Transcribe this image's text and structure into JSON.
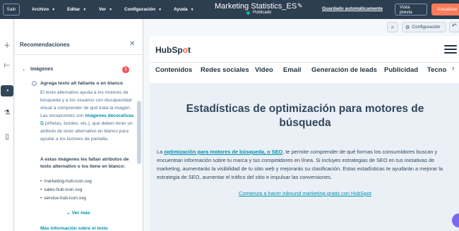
{
  "topbar": {
    "exit_label": "Salir",
    "menus": [
      "Archivo",
      "Editar",
      "Ver",
      "Configuración",
      "Ayuda"
    ],
    "doc_title": "Marketing Statistics_ES",
    "status": "Publicado",
    "autosave": "Guardado automáticamente",
    "preview_label": "Vista previa",
    "update_label": "Actualizar"
  },
  "panel": {
    "title": "Recomendaciones",
    "section_title": "Imágenes",
    "section_count": "1",
    "rec_title": "Agrega texto alt faltante o en blanco",
    "rec_body_1": "El texto alternativo ayuda a los motores de búsqueda y a los usuarios con discapacidad visual a comprender de qué trata la imagen. Las excepciones son ",
    "rec_body_link": "imágenes decorativas",
    "rec_body_2": " (viñetas, bordes, etc.), que deben tener un atributo de texto alternativo en blanco para ayudar a los lectores de pantalla.",
    "missing_title": "A estas imágenes les faltan atributos de texto alternativo o los tiene en blanco:",
    "files": [
      "marketing-hub-icon.svg",
      "sales-hub-icon.svg",
      "service-hub-icon.svg"
    ],
    "see_more": "Ver más",
    "more_info": "Más información sobre el texto"
  },
  "toolbar": {
    "config_label": "Configuración"
  },
  "page": {
    "logo_a": "HubSp",
    "logo_o": "o",
    "logo_b": "t",
    "nav": [
      "Contenidos",
      "Redes sociales",
      "Video",
      "Email",
      "Generación de leads",
      "Publicidad",
      "Tecno"
    ],
    "heading": "Estadísticas de optimización para motores de búsqueda",
    "para_1": "La ",
    "para_link": "optimización para motores de búsqueda, o SEO",
    "para_2": ", te permite comprender de qué formas los consumidores buscan y encuentran información sobre tu marca y tus competidores en línea. Si incluyes estrategias de SEO en tus iniciativas de marketing, aumentarás la visibilidad de tu sitio web y mejorarás su clasificación. Estas estadísticas te ayudarán a mejorar la estrategia de SEO, aumentar el tráfico del sitio e impulsar las conversiones.",
    "cta": "Comienza a hacer inbound marketing gratis con HubSpot"
  },
  "colors": {
    "topbar": "#2d3e50",
    "accent": "#ff7a59",
    "link": "#0091ae",
    "published": "#00bda5"
  }
}
